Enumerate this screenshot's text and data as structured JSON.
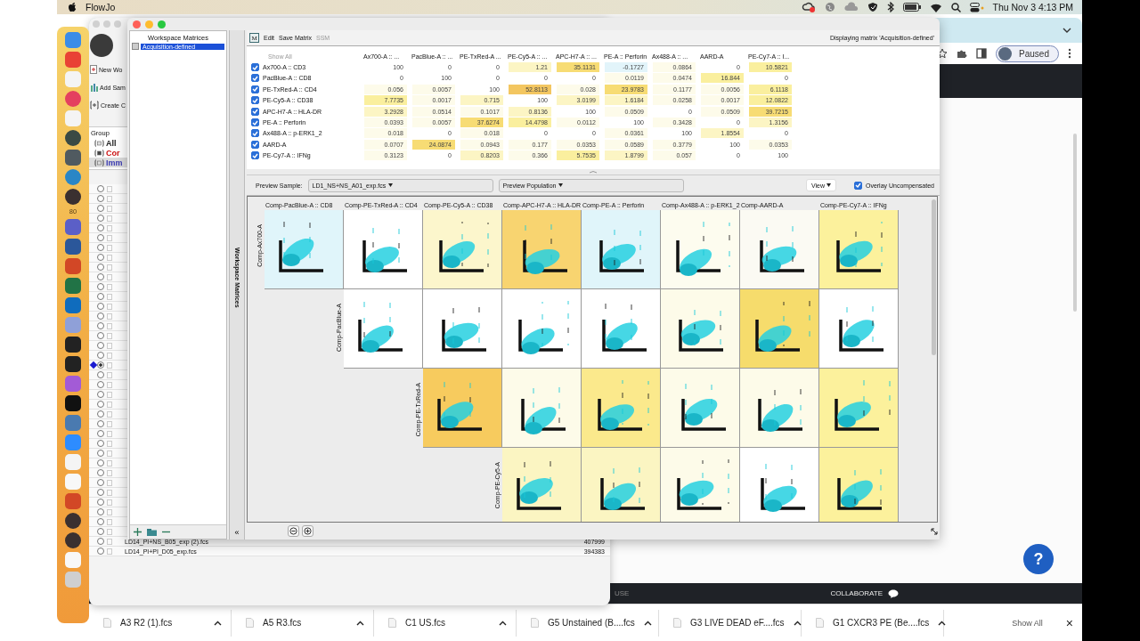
{
  "menu_bar": {
    "app_name": "FlowJo",
    "clock": "Thu Nov 3 4:13 PM"
  },
  "dock": {
    "badge": "80"
  },
  "browser": {
    "profile_button": "Paused",
    "partial_text": "USE",
    "collaborate": "COLLABORATE",
    "help": "?",
    "downloads": [
      {
        "name": "A3 R2 (1).fcs"
      },
      {
        "name": "A5 R3.fcs"
      },
      {
        "name": "C1 US.fcs"
      },
      {
        "name": "G5 Unstained (B....fcs"
      },
      {
        "name": "G3 LIVE DEAD eF....fcs"
      },
      {
        "name": "G1 CXCR3 PE (Be....fcs"
      }
    ],
    "show_all": "Show All",
    "close": "×"
  },
  "workspace_window": {
    "toolbar_items": [
      "New Wo",
      "Add Sam",
      "Create C"
    ],
    "group_header": "Group",
    "groups": [
      {
        "label": "All",
        "color": "#222222",
        "selected": false
      },
      {
        "label": "Cor",
        "color": "#cc1111",
        "selected": false
      },
      {
        "label": "Imm",
        "color": "#3b3bb3",
        "selected": true
      }
    ],
    "rows": [
      {
        "selected": false
      },
      {
        "selected": false
      },
      {
        "selected": false
      },
      {
        "selected": false
      },
      {
        "selected": false
      },
      {
        "selected": false
      },
      {
        "selected": false
      },
      {
        "selected": false
      },
      {
        "selected": false
      },
      {
        "selected": false
      },
      {
        "selected": false
      },
      {
        "selected": false
      },
      {
        "selected": false
      },
      {
        "selected": false
      },
      {
        "selected": false
      },
      {
        "selected": false
      },
      {
        "selected": false
      },
      {
        "selected": false
      },
      {
        "selected": true
      },
      {
        "selected": false
      },
      {
        "selected": false
      },
      {
        "selected": false
      },
      {
        "selected": false
      },
      {
        "selected": false
      },
      {
        "selected": false
      },
      {
        "selected": false
      },
      {
        "selected": false
      },
      {
        "selected": false
      },
      {
        "selected": false
      },
      {
        "selected": false
      },
      {
        "selected": false
      },
      {
        "selected": false
      },
      {
        "selected": false
      },
      {
        "selected": false
      },
      {
        "selected": false
      },
      {
        "selected": false
      },
      {
        "selected": false,
        "name": "LD14_PI+NS_B05_exp (2).fcs",
        "events": "407999"
      },
      {
        "selected": false,
        "name": "LD14_PI+PI_D05_exp.fcs",
        "events": "394383"
      }
    ]
  },
  "matrix_window": {
    "workspace_matrices": {
      "title": "Workspace Matrices",
      "items": [
        {
          "label": "Acquisition-defined",
          "selected": true
        }
      ],
      "tab_label": "Workspace Matrices",
      "collapse": "«"
    },
    "menu_icon_text": "M",
    "menu": [
      {
        "label": "Edit",
        "disabled": false
      },
      {
        "label": "Save Matrix",
        "disabled": false
      },
      {
        "label": "SSM",
        "disabled": true
      }
    ],
    "status": "Displaying matrix 'Acquisition-defined'",
    "matrix": {
      "show_all": "Show All",
      "columns": [
        "Ax700-A :: ...",
        "PacBlue-A :: ...",
        "PE-TxRed-A ...",
        "PE-Cy5-A :: ...",
        "APC-H7-A :: ...",
        "PE-A :: Perforin",
        "Ax488-A :: ...",
        "AARD-A",
        "PE-Cy7-A :: I..."
      ],
      "rows": [
        {
          "parameter": "Ax700-A :: CD3",
          "checked": true,
          "values": [
            "100",
            "0",
            "0",
            "1.21",
            "35.1131",
            "-0.1727",
            "0.0864",
            "0",
            "10.5821"
          ]
        },
        {
          "parameter": "PacBlue-A :: CD8",
          "checked": true,
          "values": [
            "0",
            "100",
            "0",
            "0",
            "0",
            "0.0119",
            "0.0474",
            "16.844",
            "0"
          ]
        },
        {
          "parameter": "PE-TxRed-A :: CD4",
          "checked": true,
          "values": [
            "0.056",
            "0.0057",
            "100",
            "52.8113",
            "0.028",
            "23.9783",
            "0.1177",
            "0.0056",
            "6.1118"
          ]
        },
        {
          "parameter": "PE-Cy5-A :: CD38",
          "checked": true,
          "values": [
            "7.7735",
            "0.0017",
            "0.715",
            "100",
            "3.0199",
            "1.6184",
            "0.0258",
            "0.0017",
            "12.0822"
          ]
        },
        {
          "parameter": "APC-H7-A :: HLA-DR",
          "checked": true,
          "values": [
            "3.2928",
            "0.0514",
            "0.1017",
            "0.8136",
            "100",
            "0.0509",
            "0",
            "0.0509",
            "39.7215"
          ]
        },
        {
          "parameter": "PE-A :: Perforin",
          "checked": true,
          "values": [
            "0.0393",
            "0.0057",
            "37.6274",
            "14.4798",
            "0.0112",
            "100",
            "0.3428",
            "0",
            "1.3156"
          ]
        },
        {
          "parameter": "Ax488-A :: p-ERK1_2",
          "checked": true,
          "values": [
            "0.018",
            "0",
            "0.018",
            "0",
            "0",
            "0.0361",
            "100",
            "1.8554",
            "0"
          ]
        },
        {
          "parameter": "AARD-A",
          "checked": true,
          "values": [
            "0.0707",
            "24.0874",
            "0.0943",
            "0.177",
            "0.0353",
            "0.0589",
            "0.3779",
            "100",
            "0.0353"
          ]
        },
        {
          "parameter": "PE-Cy7-A :: IFNg",
          "checked": true,
          "values": [
            "0.3123",
            "0",
            "0.8203",
            "0.366",
            "5.7535",
            "1.8799",
            "0.057",
            "0",
            "100"
          ]
        }
      ]
    },
    "preview": {
      "sample_label": "Preview Sample:",
      "sample": "LD1_NS+NS_A01_exp.fcs",
      "population": "Preview Population",
      "view": "View",
      "overlay": {
        "label": "Overlay Uncompensated",
        "checked": true
      }
    },
    "plots": {
      "columns": [
        "Comp-PacBlue-A :: CD8",
        "Comp-PE-TxRed-A :: CD4",
        "Comp-PE-Cy5-A :: CD38",
        "Comp-APC-H7-A :: HLA-DR",
        "Comp-PE-A :: Perforin",
        "Comp-Ax488-A :: p-ERK1_2",
        "Comp-AARD-A",
        "Comp-PE-Cy7-A :: IFNg"
      ],
      "rows": [
        {
          "label": "Comp-Ax700-A",
          "plots": [
            {
              "color": "#e0f5fa"
            },
            {
              "color": "#ffffff"
            },
            {
              "color": "#fcf6cc"
            },
            {
              "color": "#f8d470"
            },
            {
              "color": "#e0f5fa"
            },
            {
              "color": "#fdfcef"
            },
            {
              "color": "#fbfaf3"
            },
            {
              "color": "#fcf19c"
            }
          ]
        },
        {
          "label": "Comp-PacBlue-A",
          "plots": [
            {
              "color": "#ffffff"
            },
            {
              "color": "#ffffff"
            },
            {
              "color": "#ffffff"
            },
            {
              "color": "#ffffff"
            },
            {
              "color": "#fdfbe9"
            },
            {
              "color": "#f6dc6c"
            },
            {
              "color": "#ffffff"
            }
          ]
        },
        {
          "label": "Comp-PE-TxRed-A",
          "plots": [
            {
              "color": "#f7cb5e"
            },
            {
              "color": "#fdfbe9"
            },
            {
              "color": "#fbe98c"
            },
            {
              "color": "#fdfbe9"
            },
            {
              "color": "#fdfbe9"
            },
            {
              "color": "#fcf19c"
            }
          ]
        },
        {
          "label": "Comp-PE-Cy5-A",
          "plots": [
            {
              "color": "#fbf5c2"
            },
            {
              "color": "#fbf5c2"
            },
            {
              "color": "#fdfbe9"
            },
            {
              "color": "#ffffff"
            },
            {
              "color": "#fcf19c"
            }
          ]
        }
      ]
    }
  }
}
